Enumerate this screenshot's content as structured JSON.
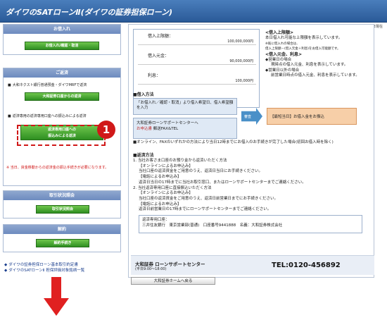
{
  "app": {
    "title": "ダイワのSATローンⅡ(ダイワの証券担保ローン)",
    "date": "XX月XX日現在"
  },
  "sidebar": {
    "borrow": {
      "header": "お借入れ",
      "button": "お借入れ/確認・取消"
    },
    "repay": {
      "header": "ご返済",
      "item1_text": "大和ネクスト銀行普通預金・ダイワMRFで返済",
      "item1_button": "大和証券口座からの返済",
      "item2_text": "返済専用の返済専用口座への振込みによる返済",
      "item2_button_line1": "返済専用口座への",
      "item2_button_line2": "振込みによる返済",
      "warning": "※ 当日、資金移動からの返済金の振込手続きが必要になります。"
    },
    "status": {
      "header": "取引状況照会",
      "button": "取引状況照会"
    },
    "cancel": {
      "header": "解約",
      "button": "解約手続き"
    }
  },
  "loan": {
    "limit_label": "借入上限額：",
    "limit_value": "100,000,000円",
    "principal_label": "借入元金：",
    "principal_value": "90,000,000円",
    "interest_label": "利息：",
    "interest_value": "100,000円"
  },
  "notes": {
    "h1": "<借入上限額>",
    "t1": "本日借入れ可能な上限額を表示しています。",
    "t1b": "※既に借入れの場合は、",
    "t1c": "借入上限額－(借入元金＋利息)をお借入可能額です。",
    "h2": "<借入元金、利息>",
    "b1": "◆営業日の場合",
    "b1t": "現時点の借入元金、利息を表示しています。",
    "b2": "◆営業日以外の場合",
    "b2t": "前営業日時点の借入元金、利息を表示しています。"
  },
  "borrow_method": {
    "title": "■借入方法",
    "step1": "「お借入れ／確認・取消」より借入希望日、借入希望額を入力",
    "step2_a": "大和証券ローンサポートセンターへ",
    "step2_b": "お申込書",
    "step2_c": "郵送FAX&TEL",
    "arrow": "審査",
    "result": "【最短当日】お借入金をお振込",
    "note": "■オンライン、FAXのいずれかの方法により当日12時までにお借入のお手続きが完了した場合(初回お借入時を除く)"
  },
  "repay_method": {
    "title": "■返済方法",
    "p1": "1. 当社お客さま口座のお預り金から返済いただく方法",
    "p1a": "【オンラインによるお申込み】",
    "p1b": "当社口座の返済資金をご用意のうえ、返済日当日にお手続きください。",
    "p1c": "【電話によるお申込み】",
    "p1d": "返済日当日の17時までに当社お取引窓口、またはローンサポートセンターまでご連絡ください。",
    "p2": "2. 当社返済専用口座に直接振込いただく方法",
    "p2a": "【オンラインによるお申込み】",
    "p2b": "当社口座の返済資金をご用意のうえ、返済日前営業日までにお手続きください。",
    "p2c": "【電話によるお申込み】",
    "p2d": "返済日前営業日の17時までにローンサポートセンターまでご連絡ください。",
    "bank_title": "返済専用口座：",
    "bank_detail": "三井住友銀行　東京営業部(普通)　口座番号9441888　名義：大和証券株式会社"
  },
  "support": {
    "name": "大和証券 ローンサポートセンター",
    "hours": "(平日9:00〜18:00)",
    "tel": "TEL:0120-456892",
    "home_button": "大和証券ホームへ戻る"
  },
  "footer": {
    "link1": "ダイワの証券担保ローン基本取引約定書",
    "link2": "ダイワのSATローンⅡ 担保評価対象銘柄一覧"
  },
  "annotation": {
    "callout_number": "1"
  },
  "colors": {
    "title_bar": "#2a5a98",
    "button_green": "#3a9a2a",
    "callout_red": "#d01818",
    "result_orange": "#f7cfa8"
  }
}
